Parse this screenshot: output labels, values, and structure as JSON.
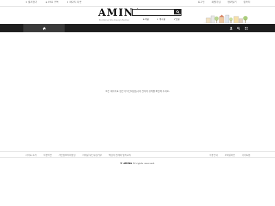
{
  "topbar": {
    "left": [
      "즐겨찾기",
      "RSS 구독",
      "페이지 다운"
    ],
    "right": [
      "로그인",
      "회원가입",
      "정보찾기",
      "접속자"
    ]
  },
  "header": {
    "logo": "AMINA",
    "tagline": "Bootstrap Site Design Builder",
    "search_placeholder": "",
    "quicklinks": [
      "새글",
      "게시글",
      "댓글"
    ]
  },
  "message": {
    "text": "모든 페이지로 접근이 차단되었습니다 관리자 공지를 확인해 주세요."
  },
  "footer": {
    "left": [
      "사이트 소개",
      "이용약관",
      "개인정보처리방침",
      "이메일 무단수집거부",
      "책임의 한계와 법적고지"
    ],
    "right": [
      "이용안내",
      "모바일버전",
      "사이트맵"
    ],
    "copyright_brand": "© AMINA",
    "copyright_text": "All rights reserved."
  }
}
